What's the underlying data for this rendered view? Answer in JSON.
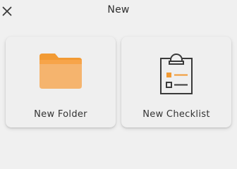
{
  "header": {
    "title": "New",
    "close_icon": "close-icon"
  },
  "options": [
    {
      "label": "New Folder",
      "icon": "folder-icon",
      "accent": "#f2a24a"
    },
    {
      "label": "New Checklist",
      "icon": "checklist-clipboard-icon",
      "accent": "#f29a33"
    }
  ],
  "colors": {
    "background": "#f0f0f0",
    "card": "#efefef",
    "text": "#333333",
    "icon_dark": "#3a3a3a"
  }
}
